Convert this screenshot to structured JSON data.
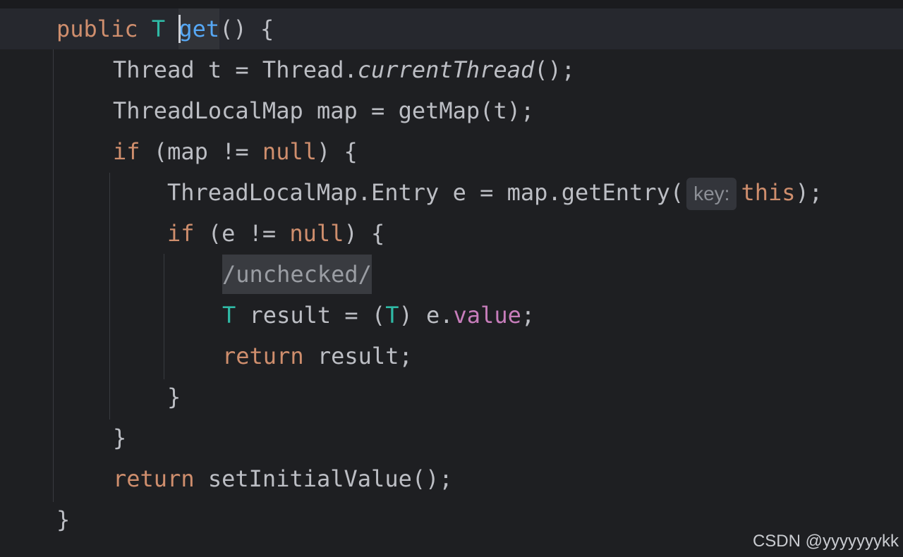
{
  "editor": {
    "language": "Java",
    "method": "get",
    "code": {
      "l1": {
        "kw_public": "public",
        "type_T": "T",
        "fn_get": "get",
        "rest": "() {"
      },
      "l2": {
        "text_a": "Thread t = Thread.",
        "italic_call": "currentThread",
        "text_b": "();"
      },
      "l3": {
        "text": "ThreadLocalMap map = getMap(t);"
      },
      "l4": {
        "kw_if": "if",
        "text_a": " (map != ",
        "kw_null": "null",
        "text_b": ") {"
      },
      "l5": {
        "text_a": "ThreadLocalMap.Entry e = map.getEntry(",
        "hint": "key:",
        "kw_this": "this",
        "text_b": ");"
      },
      "l6": {
        "kw_if": "if",
        "text_a": " (e != ",
        "kw_null": "null",
        "text_b": ") {"
      },
      "l7": {
        "folded": "/unchecked/"
      },
      "l8": {
        "type_T": "T",
        "text_a": " result = (",
        "type_T2": "T",
        "text_b": ") e.",
        "field_value": "value",
        "text_c": ";"
      },
      "l9": {
        "kw_return": "return",
        "text": " result;"
      },
      "l10": {
        "brace": "}"
      },
      "l11": {
        "brace": "}"
      },
      "l12": {
        "kw_return": "return",
        "text": " setInitialValue();"
      },
      "l13": {
        "brace": "}"
      }
    },
    "colors": {
      "background": "#1e1f22",
      "keyword": "#cf8e6d",
      "type": "#2fbaa6",
      "function": "#56a8f5",
      "field": "#c77dbb",
      "text": "#bcbec4"
    }
  },
  "watermark": "CSDN @yyyyyyykk"
}
